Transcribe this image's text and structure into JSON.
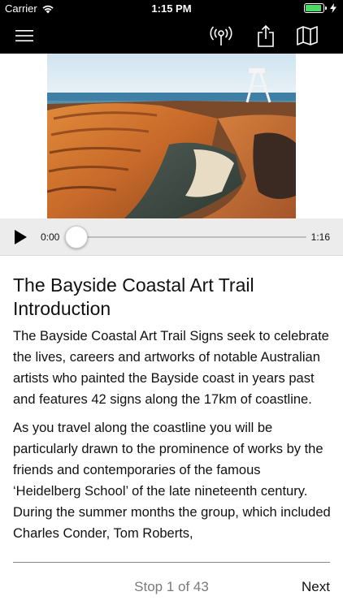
{
  "status_bar": {
    "carrier": "Carrier",
    "time": "1:15 PM",
    "battery_level": 0.9,
    "battery_color": "#4cd964"
  },
  "nav": {
    "menu_icon": "hamburger-menu-icon",
    "broadcast_icon": "broadcast-icon",
    "share_icon": "share-icon",
    "map_icon": "map-icon"
  },
  "player": {
    "current_time": "0:00",
    "duration": "1:16",
    "progress": 0.0
  },
  "article": {
    "title": "The Bayside Coastal Art Trail Introduction",
    "paragraphs": [
      "The Bayside Coastal Art Trail Signs seek to celebrate the lives, careers and artworks of notable Australian artists who painted the Bayside coast in years past and features 42 signs along the 17km of coastline.",
      "As you travel along the coastline you will be particularly drawn to the prominence of works by the friends and contemporaries of the famous ‘Heidelberg School’ of the late nineteenth century.  During the summer months the group, which included Charles Conder, Tom Roberts,"
    ]
  },
  "footer": {
    "stop_label": "Stop 1 of 43",
    "next_label": "Next"
  }
}
